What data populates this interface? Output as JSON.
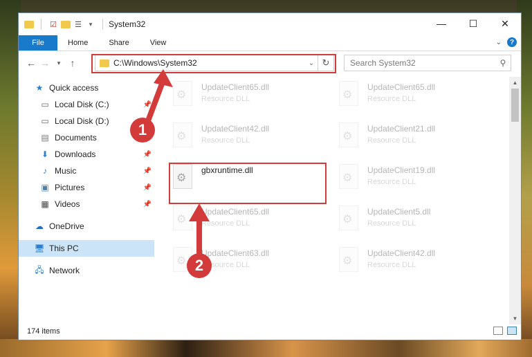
{
  "window": {
    "title": "System32",
    "controls": {
      "minimize": "—",
      "maximize": "☐",
      "close": "✕"
    }
  },
  "ribbon": {
    "tabs": [
      "File",
      "Home",
      "Share",
      "View"
    ],
    "help": "?"
  },
  "nav": {
    "address": "C:\\Windows\\System32",
    "search_placeholder": "Search System32"
  },
  "sidebar": {
    "items": [
      {
        "label": "Quick access",
        "icon": "star-icon"
      },
      {
        "label": "Local Disk (C:)",
        "icon": "drive-icon",
        "pinned": true
      },
      {
        "label": "Local Disk (D:)",
        "icon": "drive-icon"
      },
      {
        "label": "Documents",
        "icon": "documents-icon"
      },
      {
        "label": "Downloads",
        "icon": "downloads-icon",
        "pinned": true
      },
      {
        "label": "Music",
        "icon": "music-icon",
        "pinned": true
      },
      {
        "label": "Pictures",
        "icon": "pictures-icon",
        "pinned": true
      },
      {
        "label": "Videos",
        "icon": "videos-icon",
        "pinned": true
      },
      {
        "label": "OneDrive",
        "icon": "cloud-icon"
      },
      {
        "label": "This PC",
        "icon": "computer-icon",
        "selected": true
      },
      {
        "label": "Network",
        "icon": "network-icon"
      }
    ]
  },
  "files": [
    {
      "name": "UpdateClient65.dll",
      "type": "Resource DLL",
      "faded": true
    },
    {
      "name": "UpdateClient65.dll",
      "type": "Resource DLL",
      "faded": true
    },
    {
      "name": "UpdateClient42.dll",
      "type": "Resource DLL",
      "faded": true
    },
    {
      "name": "UpdateClient21.dll",
      "type": "Resource DLL",
      "faded": true
    },
    {
      "name": "gbxruntime.dll",
      "type": "",
      "faded": false
    },
    {
      "name": "UpdateClient19.dll",
      "type": "Resource DLL",
      "faded": true
    },
    {
      "name": "UpdateClient65.dll",
      "type": "Resource DLL",
      "faded": true
    },
    {
      "name": "UpdateClient5.dll",
      "type": "Resource DLL",
      "faded": true
    },
    {
      "name": "UpdateClient63.dll",
      "type": "Resource DLL",
      "faded": true
    },
    {
      "name": "UpdateClient42.dll",
      "type": "Resource DLL",
      "faded": true
    }
  ],
  "status": {
    "items": "174 items"
  },
  "annotations": {
    "step1": "1",
    "step2": "2"
  },
  "colors": {
    "accent": "#1979ca",
    "highlight": "#d33a3a",
    "selected": "#cce4f7"
  }
}
